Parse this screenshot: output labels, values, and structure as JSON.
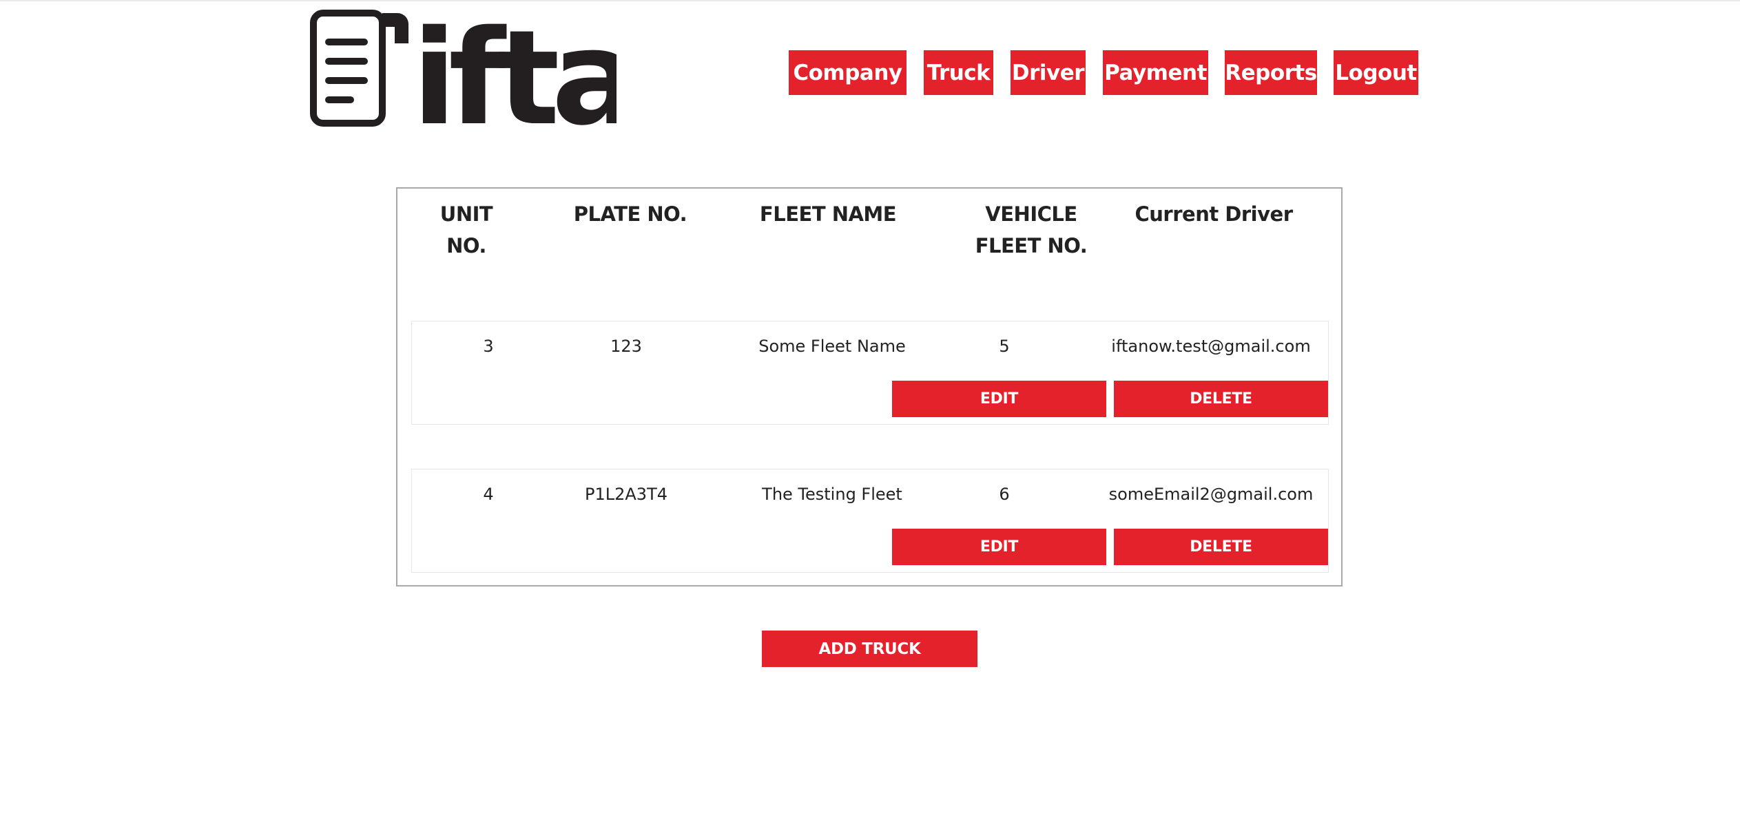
{
  "brand": {
    "logo_text": "ifta"
  },
  "nav": {
    "items": [
      {
        "label": "Company"
      },
      {
        "label": "Truck"
      },
      {
        "label": "Driver"
      },
      {
        "label": "Payment"
      },
      {
        "label": "Reports"
      },
      {
        "label": "Logout"
      }
    ]
  },
  "table": {
    "headers": {
      "unit_no": "UNIT NO.",
      "plate_no": "PLATE NO.",
      "fleet_name": "FLEET NAME",
      "vehicle_fleet_no_line1": "VEHICLE",
      "vehicle_fleet_no_line2": "FLEET NO.",
      "current_driver": "Current Driver"
    },
    "rows": [
      {
        "unit_no": "3",
        "plate_no": "123",
        "fleet_name": "Some Fleet Name",
        "vehicle_fleet_no": "5",
        "current_driver": "iftanow.test@gmail.com",
        "edit_label": "EDIT",
        "delete_label": "DELETE"
      },
      {
        "unit_no": "4",
        "plate_no": "P1L2A3T4",
        "fleet_name": "The Testing Fleet",
        "vehicle_fleet_no": "6",
        "current_driver": "someEmail2@gmail.com",
        "edit_label": "EDIT",
        "delete_label": "DELETE"
      }
    ]
  },
  "actions": {
    "add_truck_label": "ADD TRUCK"
  },
  "colors": {
    "accent": "#e3222b",
    "border": "#a9a9a9",
    "text": "#222222"
  }
}
